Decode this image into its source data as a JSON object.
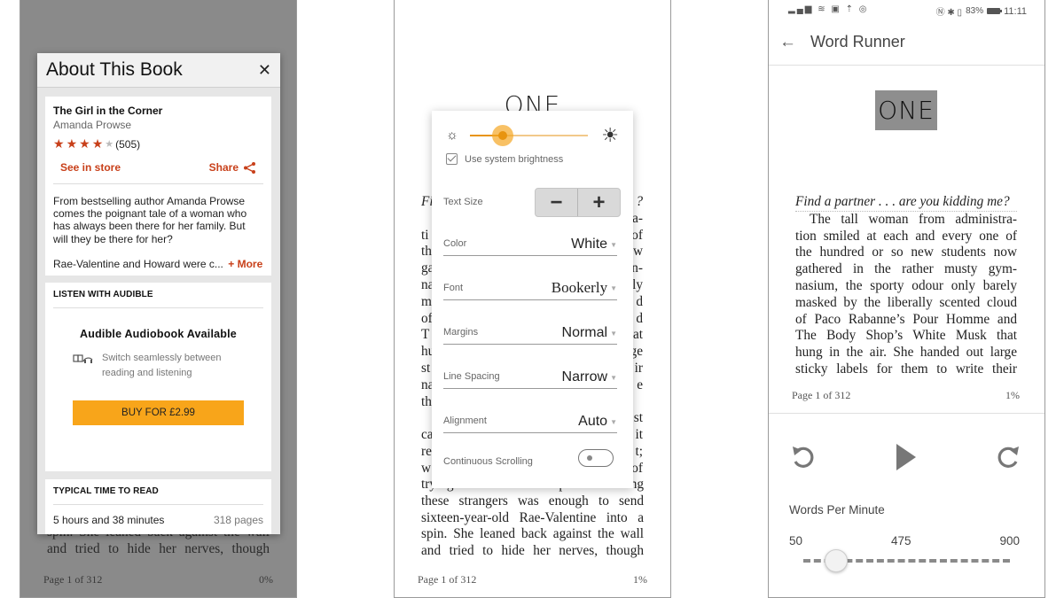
{
  "book_common": {
    "chapter_heading": "ONE",
    "page_label": "Page 1 of 312"
  },
  "panel1": {
    "progress": "0%",
    "background_lines": [
      "spin. She leaned back against the wall",
      "and tried to hide her nerves, though"
    ],
    "dialog": {
      "title": "About This Book",
      "close_icon": "close-icon",
      "book": {
        "title": "The Girl in the Corner",
        "author": "Amanda Prowse",
        "rating": 4,
        "rating_max": 5,
        "review_count": "(505)",
        "see_in_store": "See in store",
        "share": "Share",
        "description_lines": [
          "From bestselling author Amanda Prowse",
          "comes the poignant tale of a woman who",
          "has always been there for her family. But",
          "will they be there for her?"
        ],
        "teaser": "Rae-Valentine and Howard were c...",
        "more": "+ More"
      },
      "audible": {
        "section_title": "LISTEN WITH AUDIBLE",
        "heading": "Audible Audiobook Available",
        "feature_icon": "book-headphones-icon",
        "feature_line1": "Switch seamlessly between",
        "feature_line2": "reading and listening",
        "buy_label": "BUY FOR £2.99"
      },
      "read_time": {
        "section_title": "TYPICAL TIME TO READ",
        "duration": "5 hours and 38 minutes",
        "pages": "318 pages"
      }
    }
  },
  "panel2": {
    "progress": "1%",
    "visible_left_fragments": [
      "Fi",
      "",
      "ti",
      "th",
      "ga",
      "na",
      "m",
      "of",
      "T",
      "hu",
      "st",
      "na",
      "th",
      "",
      "ca",
      "re",
      "w"
    ],
    "visible_right_fragments": [
      "?",
      "a-",
      "of",
      "w",
      "n-",
      "ly",
      "d",
      "d",
      "at",
      "ge",
      "ir",
      "e",
      "",
      "st",
      "it",
      "t;",
      "of"
    ],
    "bottom_lines": [
      "trying to seek out a partner among",
      "these strangers was enough to send",
      "sixteen-year-old Rae-Valentine into a",
      "spin. She leaned back against the wall",
      "and tried to hide her nerves, though"
    ],
    "settings": {
      "brightness_fraction": 0.28,
      "use_system_brightness_label": "Use system brightness",
      "use_system_brightness": true,
      "text_size_label": "Text Size",
      "decrease_label": "−",
      "increase_label": "+",
      "rows": [
        {
          "label": "Color",
          "value": "White"
        },
        {
          "label": "Font",
          "value": "Bookerly"
        },
        {
          "label": "Margins",
          "value": "Normal"
        },
        {
          "label": "Line Spacing",
          "value": "Narrow"
        },
        {
          "label": "Alignment",
          "value": "Auto"
        }
      ],
      "continuous_scrolling_label": "Continuous Scrolling",
      "continuous_scrolling": false
    }
  },
  "panel3": {
    "status_bar": {
      "left_icons": "signal wifi nfc-card upload instagram",
      "left_glyphs": "▂▄▆ ≋ ▣ ⇡ ◎",
      "right_glyphs": "Ⓝ ✱ ▯",
      "battery": "83%",
      "time": "11:11"
    },
    "title": "Word Runner",
    "current_word": "ONE",
    "text_lines": [
      "Find a partner . . . are you kidding me?",
      "The tall woman from administra-",
      "tion smiled at each and every one of",
      "the hundred or so new students now",
      "gathered in the rather musty gym-",
      "nasium, the sporty odour only barely",
      "masked by the liberally scented cloud",
      "of Paco Rabanne’s Pour Homme and",
      "The Body Shop’s White Musk that",
      "hung in the air. She handed out large",
      "sticky labels for them to write their"
    ],
    "progress": "1%",
    "wpm": {
      "label": "Words Per Minute",
      "min": "50",
      "mid": "475",
      "max": "900",
      "value_fraction": 0.16
    }
  }
}
